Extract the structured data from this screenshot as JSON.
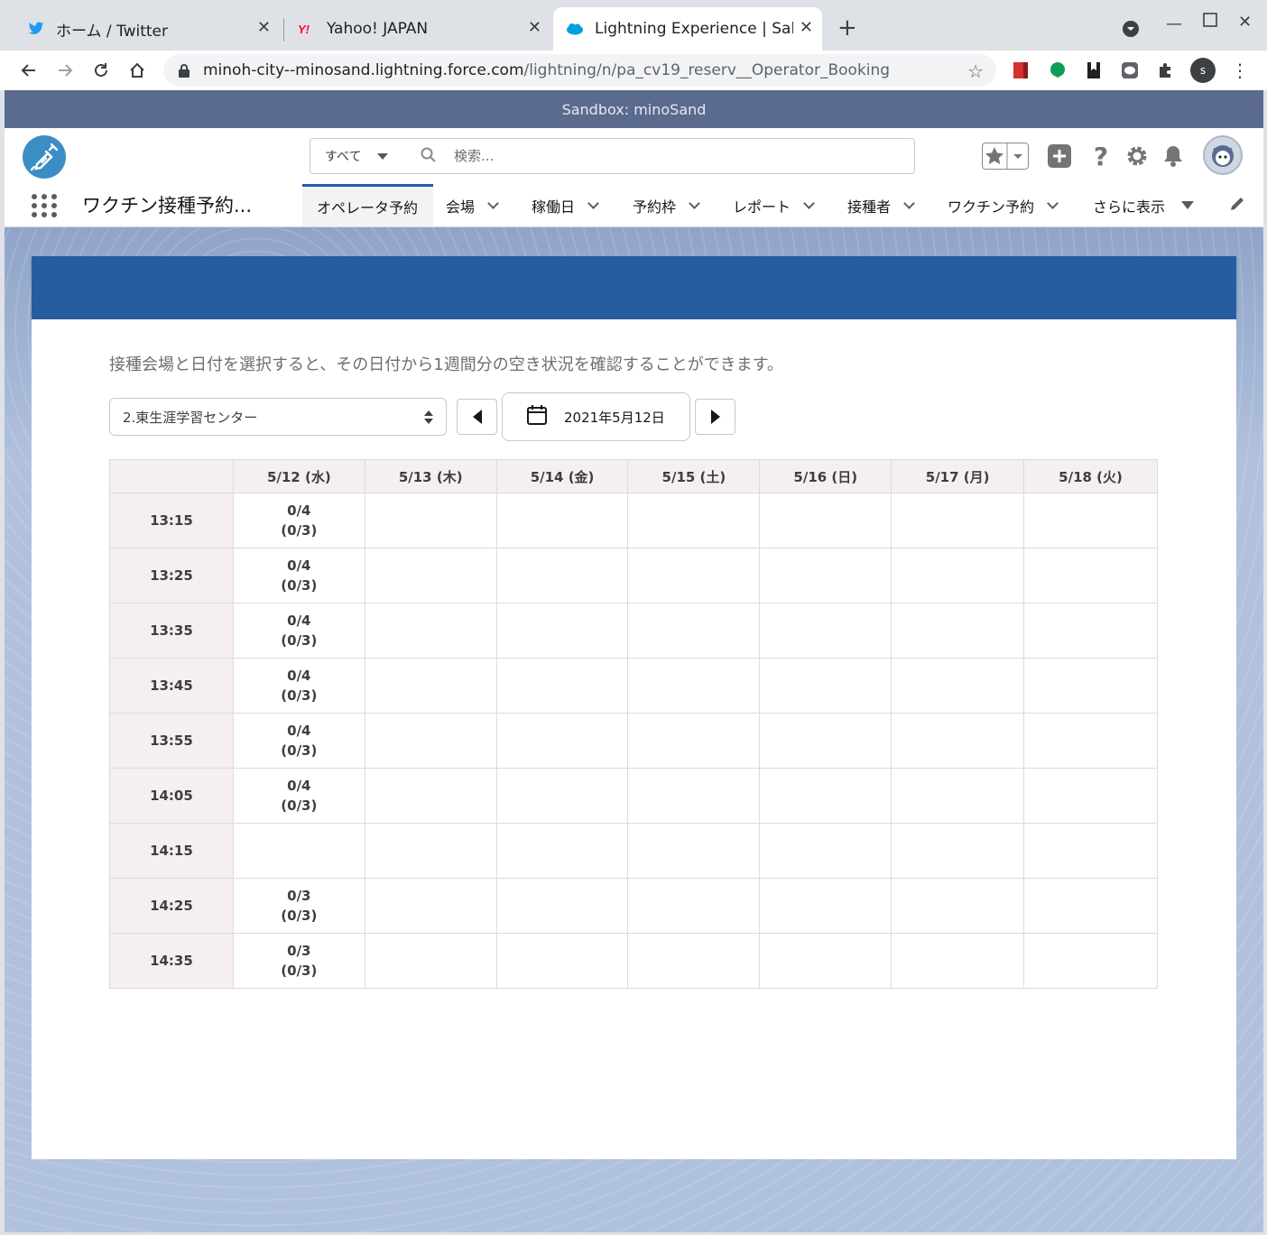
{
  "browser": {
    "tabs": [
      {
        "title": "ホーム / Twitter",
        "icon": "twitter-icon"
      },
      {
        "title": "Yahoo! JAPAN",
        "icon": "yahoo-icon"
      },
      {
        "title": "Lightning Experience | Sal",
        "icon": "salesforce-icon",
        "active": true
      }
    ],
    "url_host": "minoh-city--minosand.lightning.force.com",
    "url_path": "/lightning/n/pa_cv19_reserv__Operator_Booking",
    "profile_initial": "S"
  },
  "sandbox_label": "Sandbox: minoSand",
  "header": {
    "search_scope": "すべて",
    "search_placeholder": "検索..."
  },
  "nav": {
    "app_name": "ワクチン接種予約...",
    "items": [
      {
        "label": "オペレータ予約",
        "active": true
      },
      {
        "label": "会場"
      },
      {
        "label": "稼働日"
      },
      {
        "label": "予約枠"
      },
      {
        "label": "レポート"
      },
      {
        "label": "接種者"
      },
      {
        "label": "ワクチン予約"
      },
      {
        "label": "さらに表示"
      }
    ]
  },
  "page": {
    "intro": "接種会場と日付を選択すると、その日付から1週間分の空き状況を確認することができます。",
    "venue_selected": "2.東生涯学習センター",
    "date_value": "2021年5月12日"
  },
  "schedule": {
    "columns": [
      "",
      "5/12 (水)",
      "5/13 (木)",
      "5/14 (金)",
      "5/15 (土)",
      "5/16 (日)",
      "5/17 (月)",
      "5/18 (火)"
    ],
    "rows": [
      {
        "time": "13:15",
        "cells": [
          [
            "0/4",
            "(0/3)"
          ],
          [],
          [],
          [],
          [],
          [],
          []
        ]
      },
      {
        "time": "13:25",
        "cells": [
          [
            "0/4",
            "(0/3)"
          ],
          [],
          [],
          [],
          [],
          [],
          []
        ]
      },
      {
        "time": "13:35",
        "cells": [
          [
            "0/4",
            "(0/3)"
          ],
          [],
          [],
          [],
          [],
          [],
          []
        ]
      },
      {
        "time": "13:45",
        "cells": [
          [
            "0/4",
            "(0/3)"
          ],
          [],
          [],
          [],
          [],
          [],
          []
        ]
      },
      {
        "time": "13:55",
        "cells": [
          [
            "0/4",
            "(0/3)"
          ],
          [],
          [],
          [],
          [],
          [],
          []
        ]
      },
      {
        "time": "14:05",
        "cells": [
          [
            "0/4",
            "(0/3)"
          ],
          [],
          [],
          [],
          [],
          [],
          []
        ]
      },
      {
        "time": "14:15",
        "cells": [
          [],
          [],
          [],
          [],
          [],
          [],
          []
        ]
      },
      {
        "time": "14:25",
        "cells": [
          [
            "0/3",
            "(0/3)"
          ],
          [],
          [],
          [],
          [],
          [],
          []
        ]
      },
      {
        "time": "14:35",
        "cells": [
          [
            "0/3",
            "(0/3)"
          ],
          [],
          [],
          [],
          [],
          [],
          []
        ]
      }
    ]
  },
  "colors": {
    "banner": "#265da0",
    "nav_active": "#1b5fb0",
    "table_header_bg": "#f5eff0",
    "sandbox_bar": "#5b6b8f"
  }
}
